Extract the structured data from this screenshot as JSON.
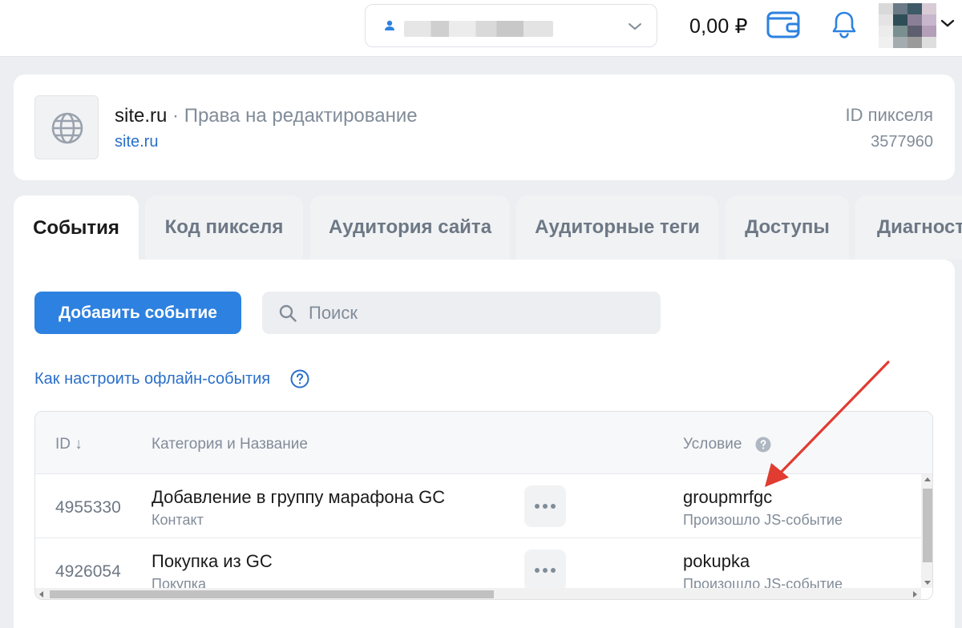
{
  "topbar": {
    "balance": "0,00 ₽",
    "account_name_redacted": ""
  },
  "pixel": {
    "site_name": "site.ru",
    "separator": " · ",
    "rights": "Права на редактирование",
    "site_link": "site.ru",
    "id_label": "ID пикселя",
    "id_value": "3577960"
  },
  "tabs": [
    {
      "label": "События",
      "active": true
    },
    {
      "label": "Код пикселя",
      "active": false
    },
    {
      "label": "Аудитория сайта",
      "active": false
    },
    {
      "label": "Аудиторные теги",
      "active": false
    },
    {
      "label": "Доступы",
      "active": false
    },
    {
      "label": "Диагностика",
      "active": false
    }
  ],
  "toolbar": {
    "add_event_label": "Добавить событие",
    "search_placeholder": "Поиск"
  },
  "help_link": "Как настроить офлайн-события",
  "table": {
    "headers": {
      "id": "ID ↓",
      "name": "Категория и Название",
      "condition": "Условие"
    },
    "rows": [
      {
        "id": "4955330",
        "name": "Добавление в группу марафона GC",
        "category": "Контакт",
        "condition": "groupmrfgc",
        "condition_type": "Произошло JS-событие"
      },
      {
        "id": "4926054",
        "name": "Покупка из GC",
        "category": "Покупка",
        "condition": "pokupka",
        "condition_type": "Произошло JS-событие"
      }
    ]
  },
  "colors": {
    "accent": "#2d81e0",
    "link": "#2a6fc9",
    "annotation_arrow": "#e03c31"
  }
}
